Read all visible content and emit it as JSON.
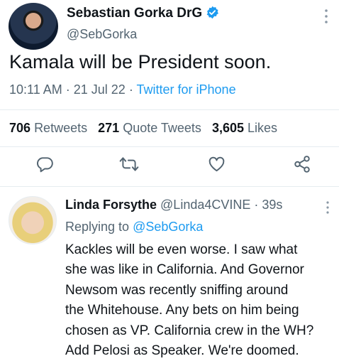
{
  "tweet": {
    "author_name": "Sebastian Gorka DrG",
    "handle": "@SebGorka",
    "text": "Kamala will be President soon.",
    "time": "10:11 AM",
    "date": "21 Jul 22",
    "source": "Twitter for iPhone",
    "sep": "·",
    "stats": {
      "retweets_count": "706",
      "retweets_label": "Retweets",
      "quotes_count": "271",
      "quotes_label": "Quote Tweets",
      "likes_count": "3,605",
      "likes_label": "Likes"
    }
  },
  "reply": {
    "author_name": "Linda Forsythe",
    "handle": "@Linda4CVINE",
    "age": "39s",
    "replying_prefix": "Replying to",
    "replying_to": "@SebGorka",
    "lines": [
      "Kackles will be even worse. I saw what",
      "she was like in California.  And Governor",
      "Newsom was recently sniffing around",
      "the Whitehouse. Any bets on him being",
      "chosen as VP. California crew in the WH?",
      "Add Pelosi as Speaker. We're doomed."
    ]
  },
  "icons": {
    "verified": "verified-badge-icon",
    "more": "more-options-icon",
    "reply": "reply-icon",
    "retweet": "retweet-icon",
    "like": "like-icon",
    "share": "share-icon"
  },
  "colors": {
    "accent": "#1d9bf0",
    "secondary_text": "#536471",
    "primary_text": "#0f1419"
  }
}
